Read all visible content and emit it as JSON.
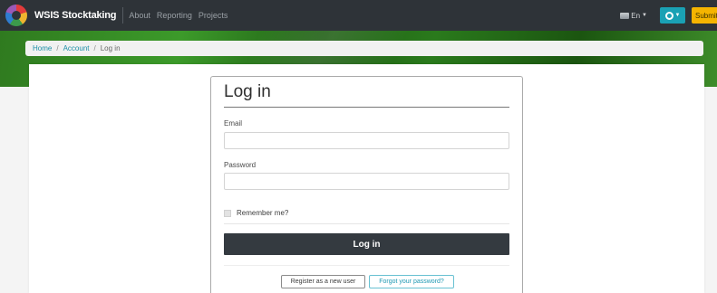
{
  "navbar": {
    "brand": "WSIS Stocktaking",
    "links": [
      "About",
      "Reporting",
      "Projects"
    ],
    "language": "En",
    "submit_label": "Submit",
    "colors": {
      "bar": "#2e3338",
      "user_button": "#1aa1b4",
      "submit_button": "#f5b400"
    }
  },
  "breadcrumb": {
    "home": "Home",
    "account": "Account",
    "current": "Log in",
    "separator": "/"
  },
  "login": {
    "title": "Log in",
    "email_label": "Email",
    "email_value": "",
    "password_label": "Password",
    "password_value": "",
    "remember_label": "Remember me?",
    "remember_checked": false,
    "submit_label": "Log in",
    "register_label": "Register as a new user",
    "forgot_label": "Forgot your password?"
  },
  "icons": {
    "logo": "wsis-logo-icon",
    "flag": "flag-icon",
    "user": "user-icon",
    "caret": "chevron-down-icon"
  }
}
